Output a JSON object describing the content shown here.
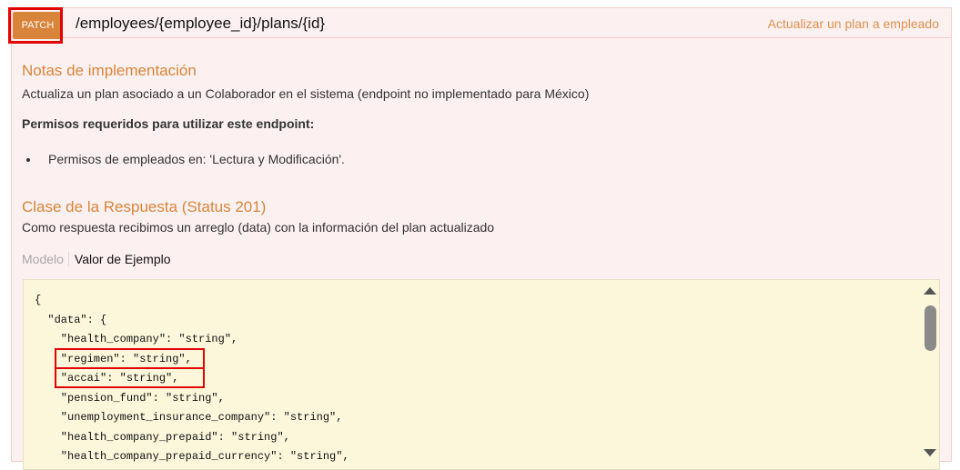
{
  "heading": {
    "method": "PATCH",
    "path": "/employees/{employee_id}/plans/{id}",
    "summary": "Actualizar un plan a empleado"
  },
  "implementation": {
    "title": "Notas de implementación",
    "description": "Actualiza un plan asociado a un Colaborador en el sistema (endpoint no implementado para México)",
    "permissions_title": "Permisos requeridos para utilizar este endpoint:",
    "permissions": [
      "Permisos de empleados en: 'Lectura y Modificación'."
    ]
  },
  "response": {
    "title": "Clase de la Respuesta (Status 201)",
    "description": "Como respuesta recibimos un arreglo (data) con la información del plan actualizado"
  },
  "tabs": {
    "model": "Modelo",
    "example": "Valor de Ejemplo"
  },
  "code": {
    "lines": [
      "{",
      "  \"data\": {",
      "    \"health_company\": \"string\",",
      "    \"regimen\": \"string\",",
      "    \"accai\": \"string\",",
      "    \"pension_fund\": \"string\",",
      "    \"unemployment_insurance_company\": \"string\",",
      "    \"health_company_prepaid\": \"string\",",
      "    \"health_company_prepaid_currency\": \"string\","
    ]
  },
  "colors": {
    "method_bg": "#d9843b",
    "panel_bg": "#fcf1f0",
    "code_bg": "#fcf6db",
    "highlight": "#e20000"
  }
}
